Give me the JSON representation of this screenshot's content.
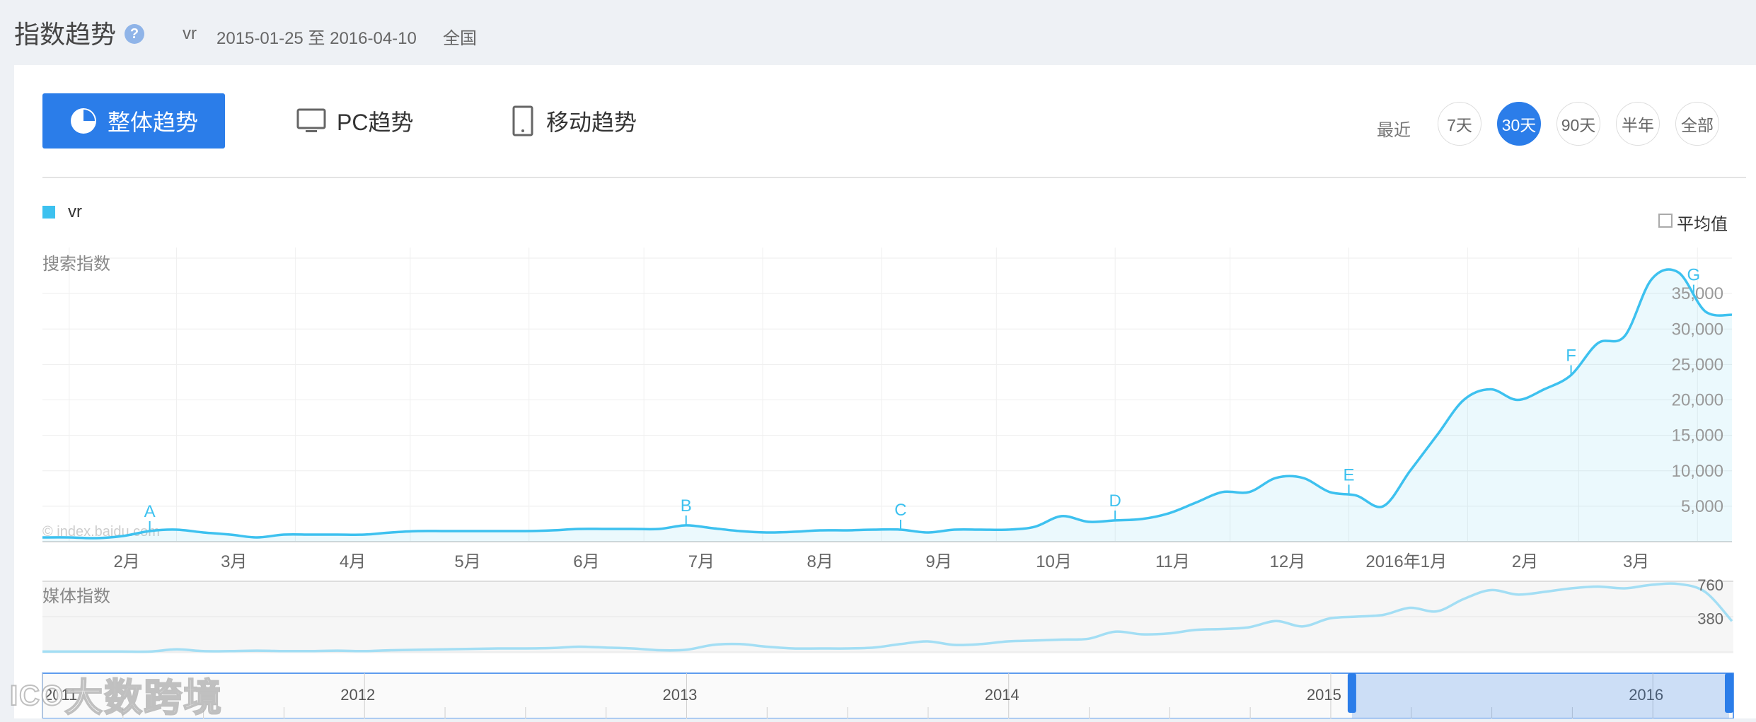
{
  "header": {
    "title": "指数趋势",
    "keyword": "vr",
    "date_range": "2015-01-25 至 2016-04-10",
    "region": "全国"
  },
  "tabs": [
    {
      "label": "整体趋势",
      "icon": "pie-chart-icon",
      "active": true
    },
    {
      "label": "PC趋势",
      "icon": "monitor-icon",
      "active": false
    },
    {
      "label": "移动趋势",
      "icon": "tablet-icon",
      "active": false
    }
  ],
  "range": {
    "label": "最近",
    "options": [
      "7天",
      "30天",
      "90天",
      "半年",
      "全部"
    ],
    "selected": "30天"
  },
  "legend": {
    "series_name": "vr"
  },
  "avg_label": "平均值",
  "watermark_chart": "© index.baidu.com",
  "watermark_logo": "大数跨境",
  "colors": {
    "accent": "#2b7de9",
    "series": "#3dc1ef",
    "media": "#a3def4"
  },
  "chart_data": [
    {
      "type": "area",
      "ylabel": "搜索指数",
      "x_tick_labels": [
        "2月",
        "3月",
        "4月",
        "5月",
        "6月",
        "7月",
        "8月",
        "9月",
        "10月",
        "11月",
        "12月",
        "2016年1月",
        "2月",
        "3月"
      ],
      "y_tick_labels": [
        "5,000",
        "10,000",
        "15,000",
        "20,000",
        "25,000",
        "30,000",
        "35,000"
      ],
      "ylim": [
        0,
        35000
      ],
      "grid": true,
      "legend": "top-left",
      "series": [
        {
          "name": "vr",
          "x": [
            "2015-01-25",
            "2015-02-01",
            "2015-02-08",
            "2015-02-15",
            "2015-02-22",
            "2015-03-01",
            "2015-03-08",
            "2015-03-15",
            "2015-03-22",
            "2015-03-29",
            "2015-04-05",
            "2015-04-12",
            "2015-04-19",
            "2015-04-26",
            "2015-05-03",
            "2015-05-10",
            "2015-05-17",
            "2015-05-24",
            "2015-05-31",
            "2015-06-07",
            "2015-06-14",
            "2015-06-21",
            "2015-06-28",
            "2015-07-05",
            "2015-07-12",
            "2015-07-19",
            "2015-07-26",
            "2015-08-02",
            "2015-08-09",
            "2015-08-16",
            "2015-08-23",
            "2015-08-30",
            "2015-09-06",
            "2015-09-13",
            "2015-09-20",
            "2015-09-27",
            "2015-10-04",
            "2015-10-11",
            "2015-10-18",
            "2015-10-25",
            "2015-11-01",
            "2015-11-08",
            "2015-11-15",
            "2015-11-22",
            "2015-11-29",
            "2015-12-06",
            "2015-12-13",
            "2015-12-20",
            "2015-12-27",
            "2016-01-03",
            "2016-01-10",
            "2016-01-17",
            "2016-01-24",
            "2016-01-31",
            "2016-02-07",
            "2016-02-14",
            "2016-02-21",
            "2016-02-28",
            "2016-03-06",
            "2016-03-13",
            "2016-03-20",
            "2016-03-27",
            "2016-04-03",
            "2016-04-10"
          ],
          "values": [
            600,
            600,
            500,
            800,
            1500,
            1700,
            1300,
            1000,
            600,
            1000,
            1000,
            1000,
            1000,
            1300,
            1500,
            1500,
            1500,
            1500,
            1500,
            1600,
            1800,
            1800,
            1800,
            1800,
            2300,
            1900,
            1500,
            1300,
            1400,
            1600,
            1600,
            1700,
            1700,
            1300,
            1700,
            1700,
            1700,
            2100,
            3600,
            2800,
            3000,
            3200,
            4000,
            5500,
            7000,
            7000,
            9000,
            9000,
            7000,
            6500,
            5000,
            10000,
            15000,
            20000,
            21500,
            20000,
            21500,
            23500,
            28000,
            29000,
            37000,
            38000,
            32500,
            32000
          ],
          "markers": [
            {
              "label": "A",
              "x": "2015-02-22"
            },
            {
              "label": "B",
              "x": "2015-07-12"
            },
            {
              "label": "C",
              "x": "2015-09-06"
            },
            {
              "label": "D",
              "x": "2015-11-01"
            },
            {
              "label": "E",
              "x": "2016-01-01"
            },
            {
              "label": "F",
              "x": "2016-02-28"
            },
            {
              "label": "G",
              "x": "2016-03-31"
            }
          ]
        }
      ]
    },
    {
      "type": "area",
      "ylabel": "媒体指数",
      "y_tick_labels": [
        "380",
        "760"
      ],
      "ylim": [
        0,
        760
      ],
      "series": [
        {
          "name": "vr",
          "values": [
            5,
            5,
            5,
            5,
            5,
            30,
            10,
            10,
            15,
            10,
            10,
            15,
            10,
            20,
            25,
            30,
            35,
            40,
            40,
            45,
            60,
            50,
            40,
            20,
            25,
            80,
            90,
            60,
            40,
            40,
            40,
            50,
            90,
            120,
            80,
            90,
            120,
            130,
            140,
            150,
            230,
            200,
            210,
            250,
            260,
            280,
            350,
            290,
            380,
            400,
            420,
            500,
            460,
            600,
            700,
            650,
            680,
            720,
            740,
            720,
            760,
            770,
            680,
            350
          ],
          "x_ticks": [
            {
              "label": "2011",
              "pos": 0
            },
            {
              "label": "2012",
              "pos": 1
            },
            {
              "label": "2013",
              "pos": 2
            },
            {
              "label": "2014",
              "pos": 3
            },
            {
              "label": "2015",
              "pos": 4
            },
            {
              "label": "2016",
              "pos": 5
            }
          ],
          "selection": [
            "2015-01-25",
            "2016-04-10"
          ]
        }
      ]
    }
  ]
}
